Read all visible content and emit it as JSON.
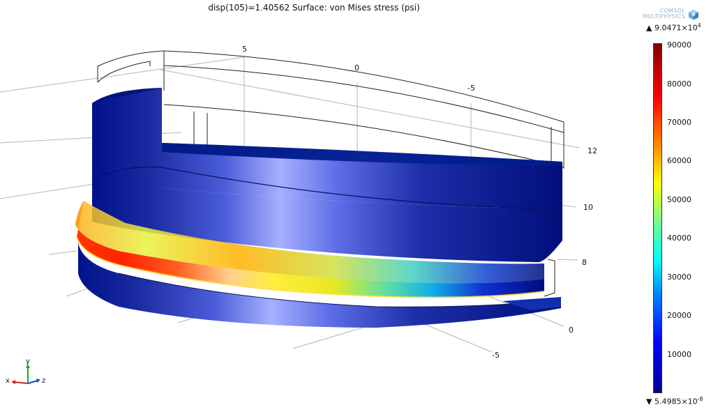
{
  "title": "disp(105)=1.40562   Surface: von Mises stress (psi)",
  "logo": {
    "line1": "COMSOL",
    "line2": "MULTIPHYSICS"
  },
  "colorbar": {
    "max_label": "9.0471×10",
    "max_exp": "4",
    "min_label": "5.4985×10",
    "min_exp": "-8",
    "ticks": [
      "90000",
      "80000",
      "70000",
      "60000",
      "50000",
      "40000",
      "30000",
      "20000",
      "10000"
    ],
    "colors": [
      "#00008f",
      "#0000ff",
      "#0080ff",
      "#00ffff",
      "#80ff80",
      "#ffff00",
      "#ff8000",
      "#ff0000",
      "#800000"
    ]
  },
  "axes": {
    "top": [
      "5",
      "0",
      "-5"
    ],
    "right": [
      "12",
      "10",
      "8",
      "0",
      "-5"
    ]
  },
  "triad": {
    "x": "x",
    "y": "y",
    "z": "z"
  }
}
